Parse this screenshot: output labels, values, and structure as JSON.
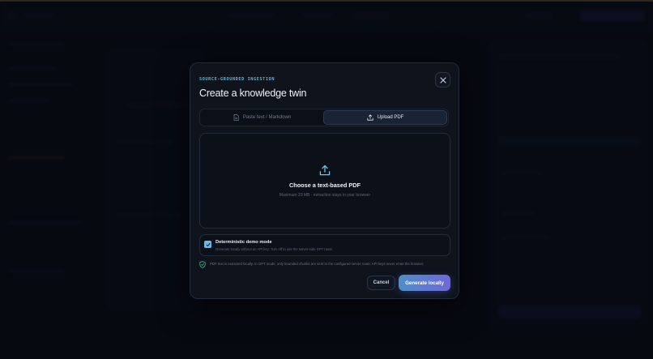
{
  "colors": {
    "accent": "#5fb7d4",
    "primary_gradient_start": "#4f8ec8",
    "primary_gradient_end": "#6f68d8",
    "checkbox": "#6cb8e8",
    "shield": "#3fb98a"
  },
  "modal": {
    "eyebrow": "SOURCE-GROUNDED INGESTION",
    "title": "Create a knowledge twin",
    "close_icon": "close-icon",
    "tabs": [
      {
        "label": "Paste text / Markdown",
        "icon": "document-icon",
        "active": false
      },
      {
        "label": "Upload PDF",
        "icon": "upload-icon",
        "active": true
      }
    ],
    "dropzone": {
      "icon": "upload-icon",
      "title": "Choose a text-based PDF",
      "subtitle": "Maximum 20 MB · extraction stays in your browser"
    },
    "demo_mode": {
      "checked": true,
      "label": "Deterministic demo mode",
      "description": "Generate locally without an API key. Turn off to use the server-side GPT route."
    },
    "privacy_note": {
      "icon": "shield-check-icon",
      "text": "PDF text is extracted locally. In GPT mode, only bounded chunks are sent to the configured server route; API keys never enter the browser."
    },
    "actions": {
      "cancel": "Cancel",
      "generate": "Generate locally"
    }
  }
}
